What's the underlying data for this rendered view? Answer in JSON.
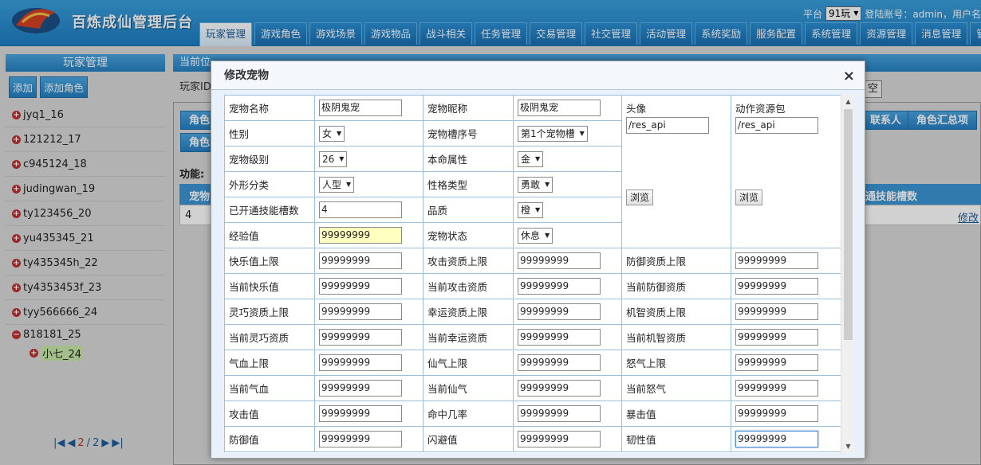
{
  "header": {
    "title": "百炼成仙管理后台",
    "platform_label": "平台",
    "platform_value": "91玩",
    "login_info": "登陆账号：admin，用户名"
  },
  "nav": [
    "玩家管理",
    "游戏角色",
    "游戏场景",
    "游戏物品",
    "战斗相关",
    "任务管理",
    "交易管理",
    "社交管理",
    "活动管理",
    "系统奖励",
    "服务配置",
    "系统管理",
    "资源管理",
    "消息管理",
    "管理"
  ],
  "sidebar": {
    "title": "玩家管理",
    "add_label": "添加",
    "add_role_label": "添加角色",
    "players": [
      "jyq1_16",
      "121212_17",
      "c945124_18",
      "judingwan_19",
      "ty123456_20",
      "yu435345_21",
      "ty435345h_22",
      "ty4353453f_23",
      "tyy566666_24",
      "818181_25"
    ],
    "child": "小七_24",
    "pager": {
      "current": "2",
      "sep": "/",
      "total": "2"
    }
  },
  "main": {
    "crumb": "当前位",
    "row_label": "玩家ID",
    "clear": "空",
    "tab1": "角色",
    "tab2": "角色",
    "tab_contact": "联系人",
    "tab_summary": "角色汇总项",
    "func": "功能:",
    "col_pet": "宠物",
    "col_skill": "通技能槽数",
    "row_val": "4",
    "edit": "修改"
  },
  "modal": {
    "title": "修改宠物",
    "close": "×",
    "labels": {
      "pet_name": "宠物名称",
      "pet_nick": "宠物昵称",
      "avatar": "头像",
      "action_res": "动作资源包",
      "gender": "性别",
      "slot": "宠物槽序号",
      "level": "宠物级别",
      "element": "本命属性",
      "shape": "外形分类",
      "personality": "性格类型",
      "skill_slots": "已开通技能槽数",
      "quality": "品质",
      "exp": "经验值",
      "state": "宠物状态",
      "browse": "浏览"
    },
    "values": {
      "pet_name": "极阴鬼宠",
      "pet_nick": "极阴鬼宠",
      "avatar": "/res_api",
      "action_res": "/res_api",
      "gender": "女",
      "slot": "第1个宠物槽",
      "level": "26",
      "element": "金",
      "shape": "人型",
      "personality": "勇敢",
      "skill_slots": "4",
      "quality": "橙",
      "exp": "99999999",
      "state": "休息"
    },
    "rows": [
      [
        {
          "l": "快乐值上限",
          "v": "99999999"
        },
        {
          "l": "攻击资质上限",
          "v": "99999999"
        },
        {
          "l": "防御资质上限",
          "v": "99999999"
        }
      ],
      [
        {
          "l": "当前快乐值",
          "v": "99999999"
        },
        {
          "l": "当前攻击资质",
          "v": "99999999"
        },
        {
          "l": "当前防御资质",
          "v": "99999999"
        }
      ],
      [
        {
          "l": "灵巧资质上限",
          "v": "99999999"
        },
        {
          "l": "幸运资质上限",
          "v": "99999999"
        },
        {
          "l": "机智资质上限",
          "v": "99999999"
        }
      ],
      [
        {
          "l": "当前灵巧资质",
          "v": "99999999"
        },
        {
          "l": "当前幸运资质",
          "v": "99999999"
        },
        {
          "l": "当前机智资质",
          "v": "99999999"
        }
      ],
      [
        {
          "l": "气血上限",
          "v": "99999999"
        },
        {
          "l": "仙气上限",
          "v": "99999999"
        },
        {
          "l": "怒气上限",
          "v": "99999999"
        }
      ],
      [
        {
          "l": "当前气血",
          "v": "99999999"
        },
        {
          "l": "当前仙气",
          "v": "99999999"
        },
        {
          "l": "当前怒气",
          "v": "99999999"
        }
      ],
      [
        {
          "l": "攻击值",
          "v": "99999999"
        },
        {
          "l": "命中几率",
          "v": "99999999"
        },
        {
          "l": "暴击值",
          "v": "99999999"
        }
      ],
      [
        {
          "l": "防御值",
          "v": "99999999"
        },
        {
          "l": "闪避值",
          "v": "99999999"
        },
        {
          "l": "韧性值",
          "v": "99999999"
        }
      ]
    ]
  }
}
